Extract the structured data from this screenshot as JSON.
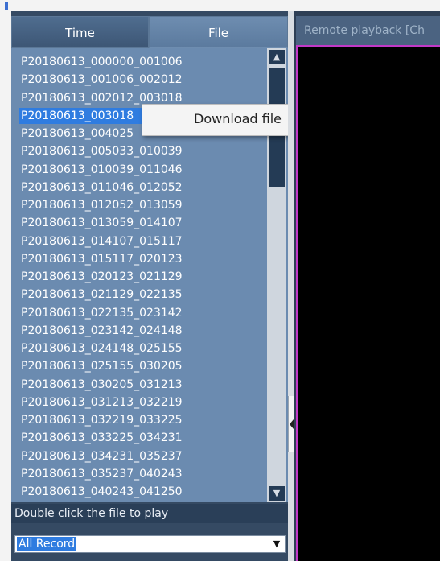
{
  "tabs": {
    "time": "Time",
    "file": "File"
  },
  "files": [
    "P20180613_000000_001006",
    "P20180613_001006_002012",
    "P20180613_002012_003018",
    "P20180613_003018",
    "P20180613_004025",
    "P20180613_005033_010039",
    "P20180613_010039_011046",
    "P20180613_011046_012052",
    "P20180613_012052_013059",
    "P20180613_013059_014107",
    "P20180613_014107_015117",
    "P20180613_015117_020123",
    "P20180613_020123_021129",
    "P20180613_021129_022135",
    "P20180613_022135_023142",
    "P20180613_023142_024148",
    "P20180613_024148_025155",
    "P20180613_025155_030205",
    "P20180613_030205_031213",
    "P20180613_031213_032219",
    "P20180613_032219_033225",
    "P20180613_033225_034231",
    "P20180613_034231_035237",
    "P20180613_035237_040243",
    "P20180613_040243_041250"
  ],
  "selected_index": 3,
  "context_menu": {
    "download": "Download file"
  },
  "hint": "Double click the file to play",
  "record_filter": {
    "value": "All Record"
  },
  "remote_tab": "Remote playback [Ch",
  "colors": {
    "accent": "#2f7ce0",
    "panel": "#354a63",
    "list_bg": "#6b8bb0",
    "video_border": "#c239c7"
  },
  "icons": {
    "scroll_up": "triangle-up",
    "scroll_down": "triangle-down",
    "dropdown": "triangle-down",
    "splitter": "triangle-left"
  }
}
